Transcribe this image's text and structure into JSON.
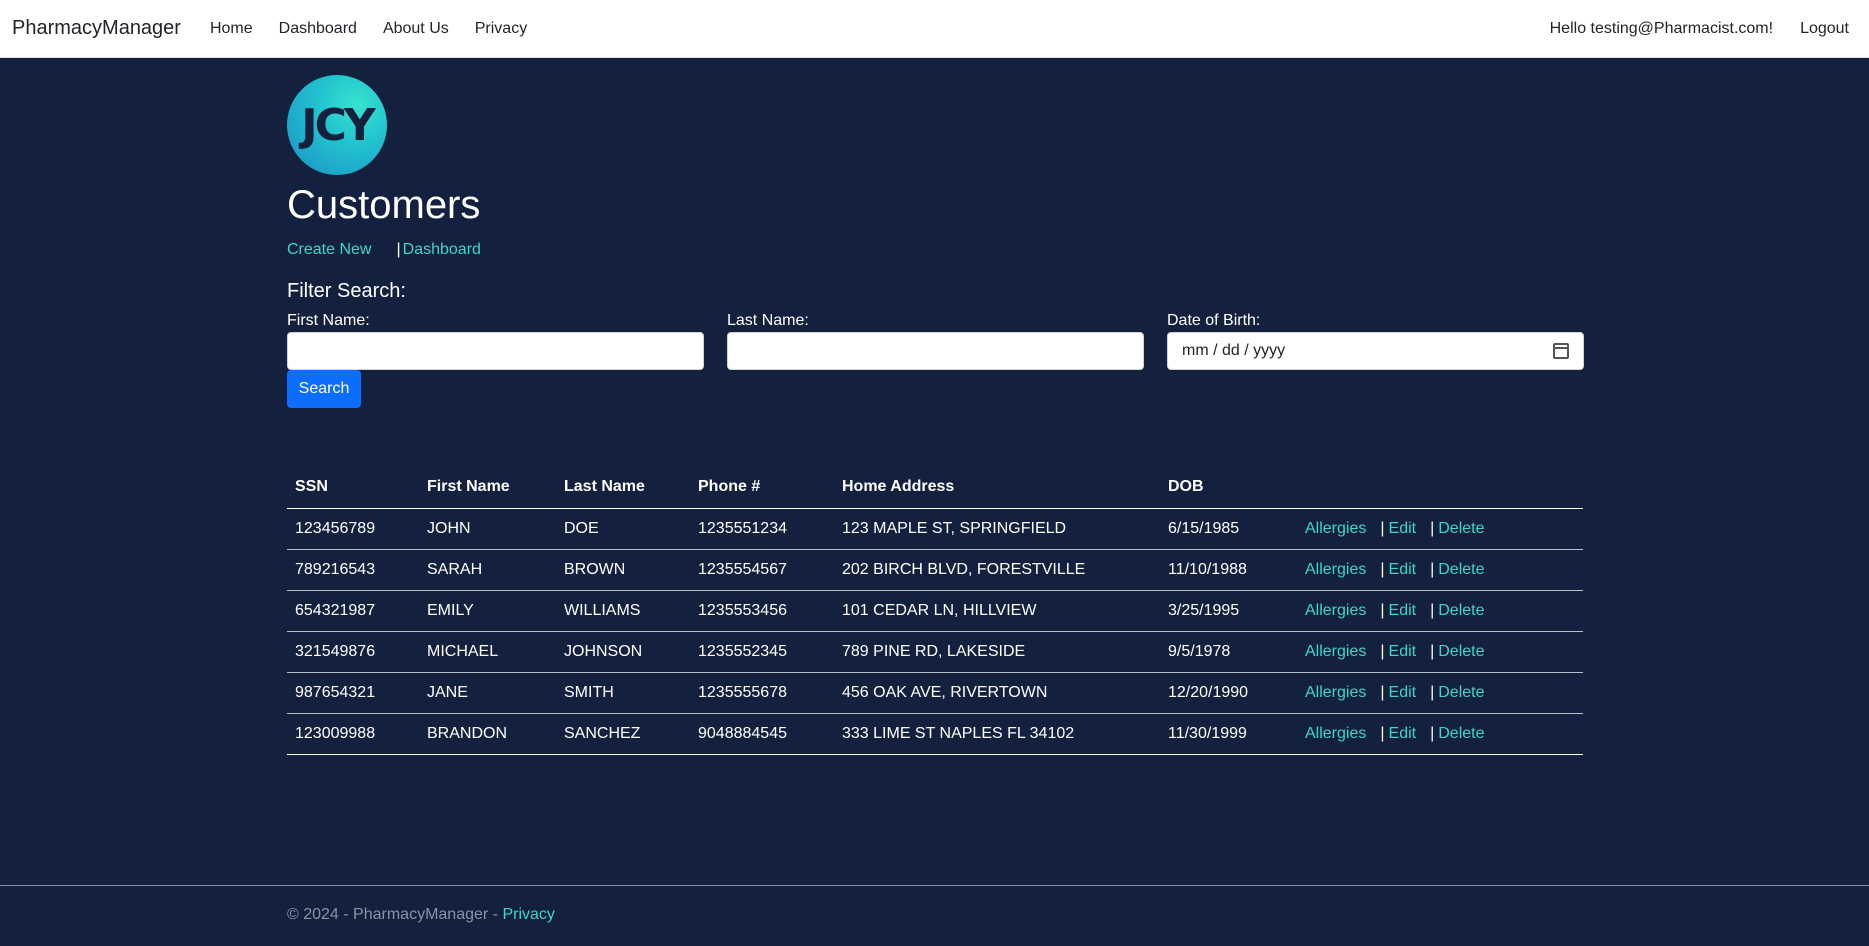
{
  "nav": {
    "brand": "PharmacyManager",
    "links": [
      "Home",
      "Dashboard",
      "About Us",
      "Privacy"
    ],
    "greeting": "Hello testing@Pharmacist.com!",
    "logout": "Logout"
  },
  "logo_text": "JCY",
  "page_title": "Customers",
  "actions": {
    "create_new": "Create New",
    "separator": "|",
    "dashboard": "Dashboard"
  },
  "filter": {
    "title": "Filter Search:",
    "first_name_label": "First Name:",
    "first_name_value": "",
    "last_name_label": "Last Name:",
    "last_name_value": "",
    "dob_label": "Date of Birth:",
    "dob_placeholder": "mm / dd / yyyy",
    "search_label": "Search"
  },
  "table": {
    "headers": [
      "SSN",
      "First Name",
      "Last Name",
      "Phone #",
      "Home Address",
      "DOB",
      ""
    ],
    "rows": [
      [
        "123456789",
        "JOHN",
        "DOE",
        "1235551234",
        "123 MAPLE ST, SPRINGFIELD",
        "6/15/1985"
      ],
      [
        "789216543",
        "SARAH",
        "BROWN",
        "1235554567",
        "202 BIRCH BLVD, FORESTVILLE",
        "11/10/1988"
      ],
      [
        "654321987",
        "EMILY",
        "WILLIAMS",
        "1235553456",
        "101 CEDAR LN, HILLVIEW",
        "3/25/1995"
      ],
      [
        "321549876",
        "MICHAEL",
        "JOHNSON",
        "1235552345",
        "789 PINE RD, LAKESIDE",
        "9/5/1978"
      ],
      [
        "987654321",
        "JANE",
        "SMITH",
        "1235555678",
        "456 OAK AVE, RIVERTOWN",
        "12/20/1990"
      ],
      [
        "123009988",
        "BRANDON",
        "SANCHEZ",
        "9048884545",
        "333 LIME ST NAPLES FL 34102",
        "11/30/1999"
      ]
    ],
    "row_actions": {
      "allergies": "Allergies",
      "edit": "Edit",
      "delete": "Delete",
      "separator": "|"
    }
  },
  "footer": {
    "text": "© 2024 - PharmacyManager - ",
    "privacy": "Privacy"
  },
  "colors": {
    "background": "#13213f",
    "link": "#3fd5c9",
    "primary_button": "#0d6efd"
  }
}
